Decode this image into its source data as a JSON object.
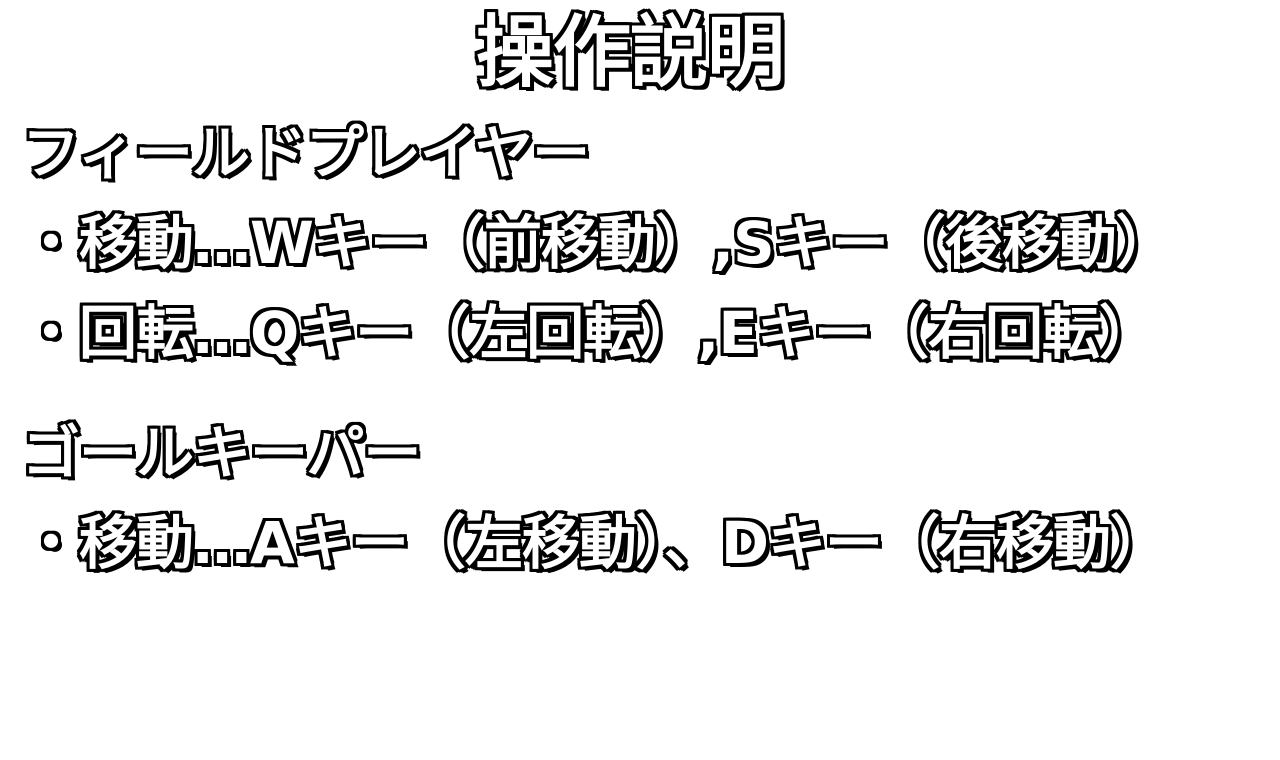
{
  "title": "操作説明",
  "field_player": {
    "heading": "フィールドプレイヤー",
    "move": "・移動…Wキー（前移動）,Sキー（後移動）",
    "rotate": "・回転…Qキー（左回転）,Eキー（右回転）"
  },
  "goalkeeper": {
    "heading": "ゴールキーパー",
    "move": "・移動…Aキー（左移動）、Dキー（右移動）"
  },
  "colors": {
    "background": "#ffffff",
    "text_fill": "#ffffff",
    "text_outline": "#000000"
  }
}
